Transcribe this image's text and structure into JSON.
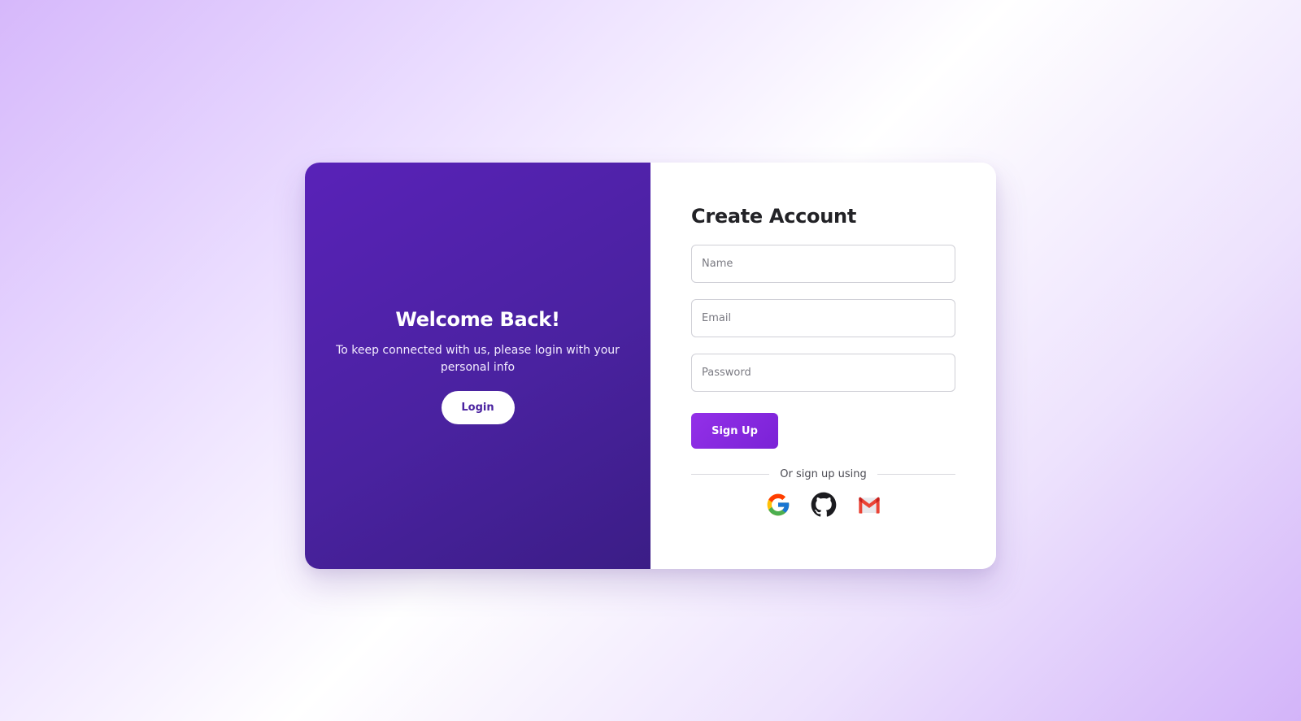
{
  "left_panel": {
    "title": "Welcome Back!",
    "text": "To keep connected with us, please login with your personal info",
    "login_label": "Login"
  },
  "form": {
    "title": "Create Account",
    "name_placeholder": "Name",
    "email_placeholder": "Email",
    "password_placeholder": "Password",
    "signup_label": "Sign Up",
    "divider_text": "Or sign up using"
  },
  "social": [
    "google-icon",
    "github-icon",
    "gmail-icon"
  ],
  "colors": {
    "panel_start": "#5922b8",
    "panel_end": "#3b1d86",
    "signup_button": "#8a2be2",
    "login_text": "#4a22a0"
  }
}
